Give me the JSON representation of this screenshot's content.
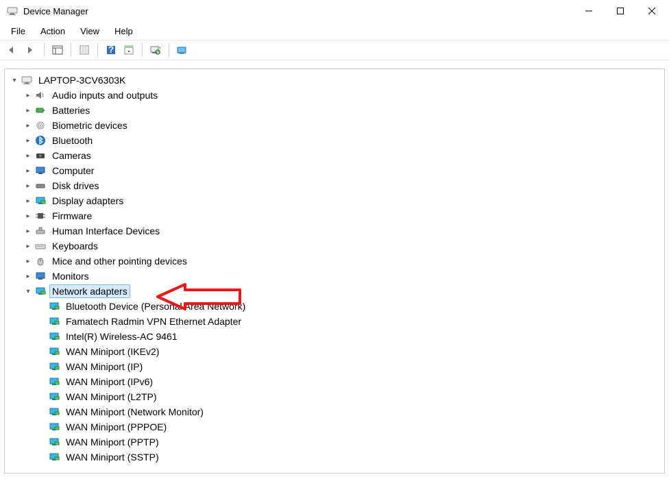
{
  "window": {
    "title": "Device Manager"
  },
  "menu": {
    "file": "File",
    "action": "Action",
    "view": "View",
    "help": "Help"
  },
  "root": {
    "label": "LAPTOP-3CV6303K"
  },
  "cats": {
    "audio": "Audio inputs and outputs",
    "batteries": "Batteries",
    "biometric": "Biometric devices",
    "bluetooth": "Bluetooth",
    "cameras": "Cameras",
    "computer": "Computer",
    "disk": "Disk drives",
    "display": "Display adapters",
    "firmware": "Firmware",
    "hid": "Human Interface Devices",
    "keyboards": "Keyboards",
    "mice": "Mice and other pointing devices",
    "monitors": "Monitors",
    "network": "Network adapters"
  },
  "net": {
    "n0": "Bluetooth Device (Personal Area Network)",
    "n1": "Famatech Radmin VPN Ethernet Adapter",
    "n2": "Intel(R) Wireless-AC 9461",
    "n3": "WAN Miniport (IKEv2)",
    "n4": "WAN Miniport (IP)",
    "n5": "WAN Miniport (IPv6)",
    "n6": "WAN Miniport (L2TP)",
    "n7": "WAN Miniport (Network Monitor)",
    "n8": "WAN Miniport (PPPOE)",
    "n9": "WAN Miniport (PPTP)",
    "n10": "WAN Miniport (SSTP)"
  }
}
